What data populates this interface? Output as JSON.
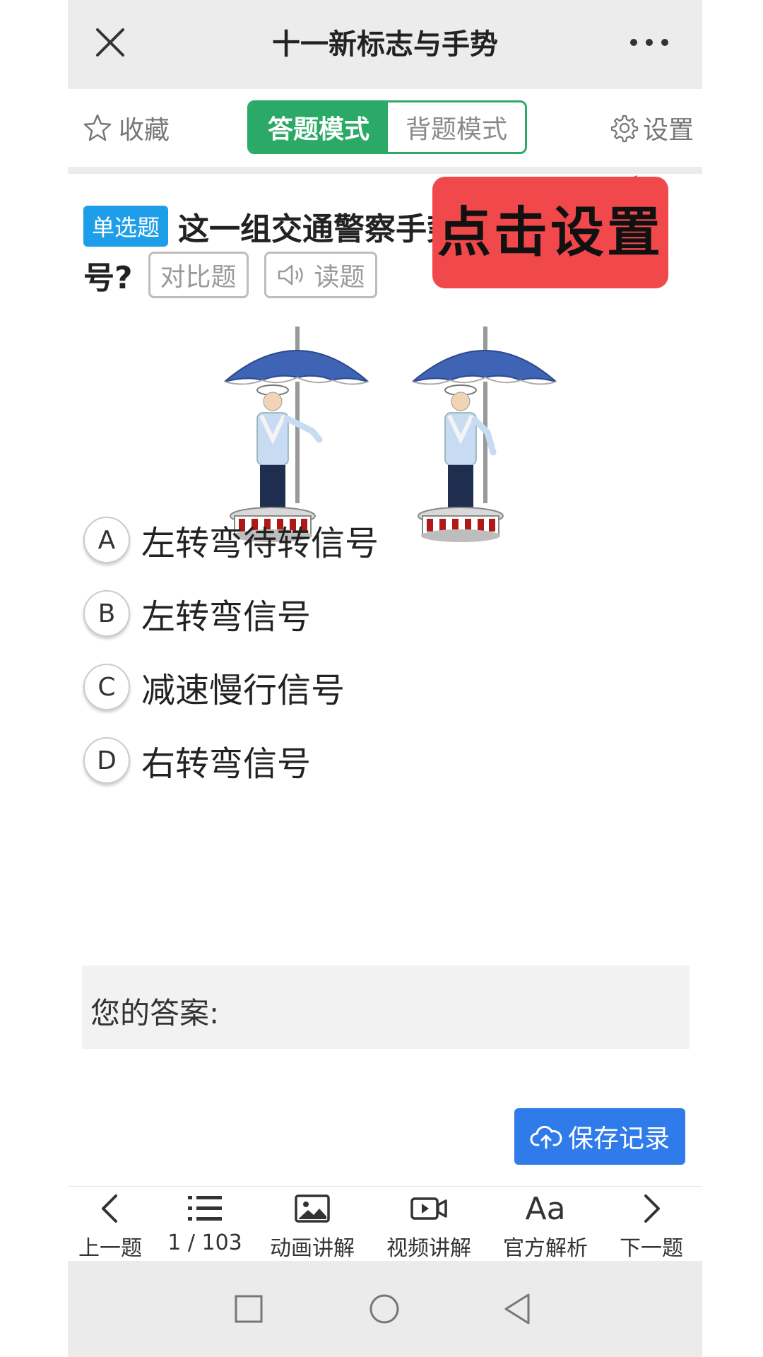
{
  "header": {
    "title": "十一新标志与手势"
  },
  "toolbar": {
    "favorite_label": "收藏",
    "modes": [
      "答题模式",
      "背题模式"
    ],
    "active_mode_index": 0,
    "settings_label": "设置"
  },
  "callout": {
    "text": "点击设置"
  },
  "question": {
    "type_badge": "单选题",
    "text_line1": "这一组交通警察手势是什么信",
    "text_line2": "号?",
    "compare_label": "对比题",
    "read_label": "读题",
    "options": [
      {
        "letter": "A",
        "text": "左转弯待转信号"
      },
      {
        "letter": "B",
        "text": "左转弯信号"
      },
      {
        "letter": "C",
        "text": "减速慢行信号"
      },
      {
        "letter": "D",
        "text": "右转弯信号"
      }
    ],
    "answer_label": "您的答案:"
  },
  "actions": {
    "save_label": "保存记录"
  },
  "bottom_nav": {
    "prev": "上一题",
    "progress": "1 / 103",
    "animation": "动画讲解",
    "video": "视频讲解",
    "official": "官方解析",
    "official_icon_text": "Aa",
    "next": "下一题"
  },
  "colors": {
    "accent_green": "#2aaa66",
    "badge_blue": "#1e9ee8",
    "save_blue": "#2f7bea",
    "callout_red": "#f1484c"
  }
}
